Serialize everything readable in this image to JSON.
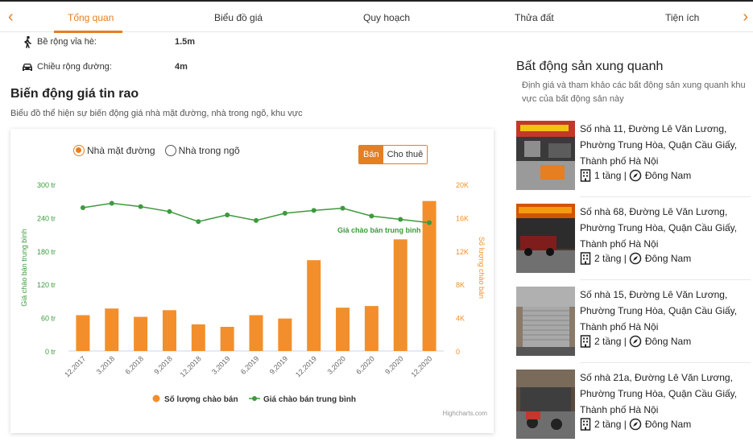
{
  "nav": {
    "tabs": [
      {
        "label": "Tổng quan"
      },
      {
        "label": "Biểu đồ giá"
      },
      {
        "label": "Quy hoạch"
      },
      {
        "label": "Thửa đất"
      },
      {
        "label": "Tiện ích"
      }
    ],
    "prev_arrow": "‹",
    "next_arrow": "›"
  },
  "info": [
    {
      "icon": "pedestrian-icon",
      "label": "Bề rộng vỉa hè:",
      "value": "1.5m"
    },
    {
      "icon": "car-icon",
      "label": "Chiều rộng đường:",
      "value": "4m"
    }
  ],
  "price_section": {
    "title": "Biến động giá tin rao",
    "subtitle": "Biểu đồ thể hiện sự biến động giá nhà mặt đường, nhà trong ngõ, khu vực"
  },
  "chart_controls": {
    "radio": [
      {
        "label": "Nhà mặt đường",
        "selected": true
      },
      {
        "label": "Nhà trong ngõ",
        "selected": false
      }
    ],
    "segment": [
      {
        "label": "Bán",
        "selected": true
      },
      {
        "label": "Cho thuê",
        "selected": false
      }
    ]
  },
  "chart_data": {
    "type": "bar",
    "categories": [
      "12,2017",
      "3,2018",
      "6,2018",
      "9,2018",
      "12,2018",
      "3,2019",
      "6,2019",
      "9,2019",
      "12,2019",
      "3,2020",
      "6,2020",
      "9,2020",
      "12,2020"
    ],
    "series": [
      {
        "name": "Số lượng chào bán",
        "type": "bar",
        "axis": "right",
        "color": "#f28f2c",
        "values": [
          4300,
          5100,
          4100,
          4900,
          3200,
          2900,
          4300,
          3900,
          10900,
          5200,
          5400,
          13400,
          18000
        ]
      },
      {
        "name": "Giá chào bán trung bình",
        "type": "line",
        "axis": "left",
        "color": "#3d9a3d",
        "values": [
          258,
          266,
          260,
          251,
          233,
          245,
          235,
          248,
          253,
          257,
          243,
          237,
          231
        ]
      }
    ],
    "left_axis": {
      "label": "Giá chào bán trung bình",
      "ticks": [
        "0 tr",
        "60 tr",
        "120 tr",
        "180 tr",
        "240 tr",
        "300 tr"
      ],
      "min": 0,
      "max": 300
    },
    "right_axis": {
      "label": "Số lượng chào bán",
      "ticks": [
        "0",
        "4K",
        "8K",
        "12K",
        "16K",
        "20K"
      ],
      "min": 0,
      "max": 20000
    },
    "annotation": "Giá chào bán trung bình",
    "legend": [
      {
        "label": "Số lượng chào bán",
        "color": "#f28f2c"
      },
      {
        "label": "Giá chào bán trung bình",
        "color": "#3d9a3d"
      }
    ],
    "legend_position": "bottom-center",
    "credit": "Highcharts.com",
    "grid": false
  },
  "nearby": {
    "title": "Bất động sản xung quanh",
    "subtitle": "Định giá và tham khảo các bất động sản xung quanh khu vực của bất động sản này",
    "items": [
      {
        "address": "Số nhà 11, Đường Lê Văn Lương, Phường Trung Hòa, Quận Cầu Giấy, Thành phố Hà Nội",
        "floors": "1 tầng |",
        "direction": "Đông Nam"
      },
      {
        "address": "Số nhà 68, Đường Lê Văn Lương, Phường Trung Hòa, Quận Cầu Giấy, Thành phố Hà Nội",
        "floors": "2 tầng |",
        "direction": "Đông Nam"
      },
      {
        "address": "Số nhà 15, Đường Lê Văn Lương, Phường Trung Hòa, Quận Cầu Giấy, Thành phố Hà Nội",
        "floors": "2 tầng |",
        "direction": "Đông Nam"
      },
      {
        "address": "Số nhà 21a, Đường Lê Văn Lương, Phường Trung Hòa, Quận Cầu Giấy, Thành phố Hà Nội",
        "floors": "2 tầng |",
        "direction": "Đông Nam"
      }
    ]
  },
  "colors": {
    "accent": "#e67e22",
    "bar": "#f28f2c",
    "line": "#3d9a3d"
  }
}
